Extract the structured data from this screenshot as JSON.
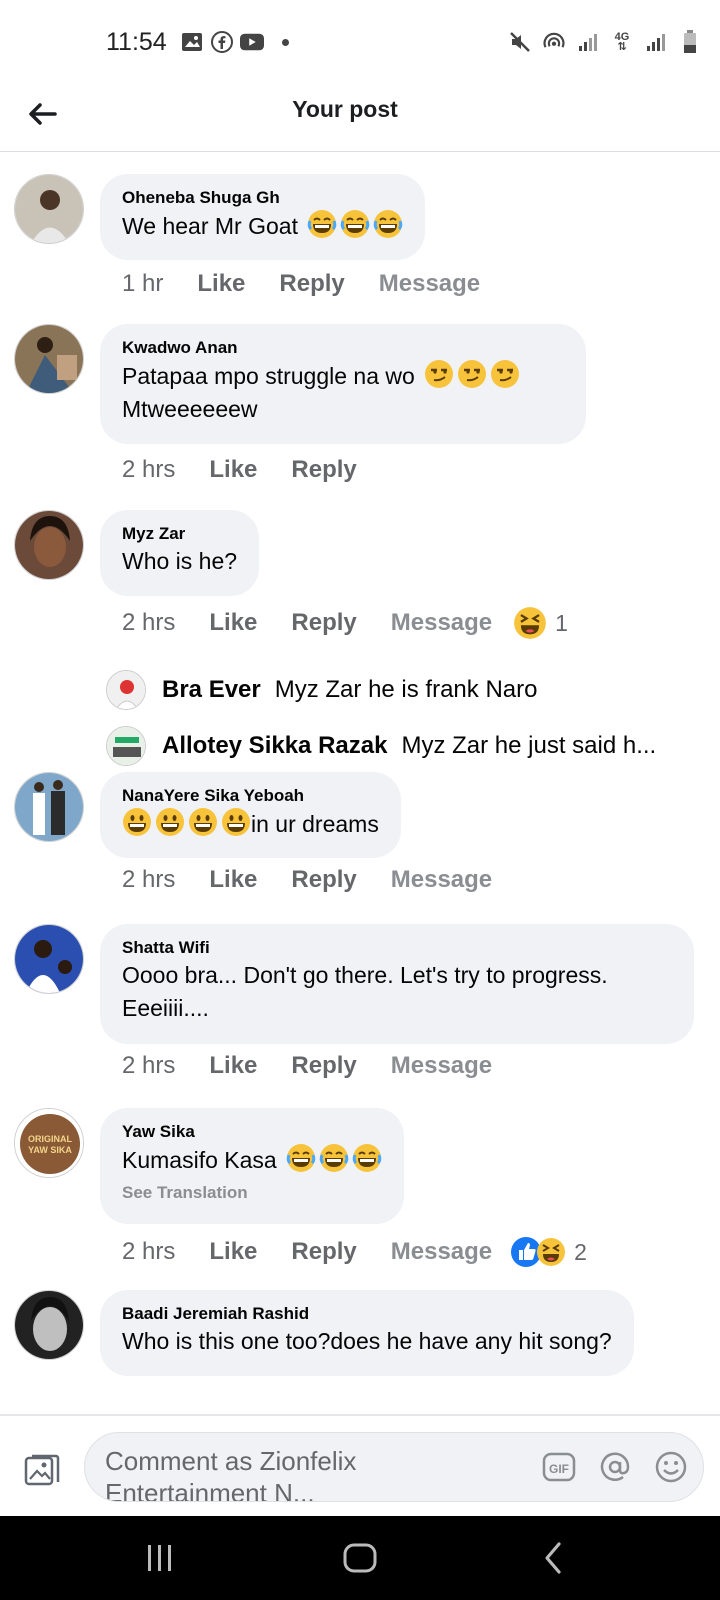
{
  "status_bar": {
    "time": "11:54",
    "icons_left": [
      "image-icon",
      "facebook-icon",
      "youtube-icon",
      "dot-icon"
    ],
    "icons_right": [
      "mute-icon",
      "hotspot-icon",
      "signal-icon",
      "4g-icon",
      "signal-icon",
      "battery-icon"
    ],
    "network_label": "4G"
  },
  "header": {
    "title": "Your post"
  },
  "comments": [
    {
      "name": "Oheneba Shuga Gh",
      "text": "We hear Mr Goat",
      "emojis": [
        "joy",
        "joy",
        "joy"
      ],
      "time": "1 hr",
      "like": "Like",
      "reply": "Reply",
      "message": "Message"
    },
    {
      "name": "Kwadwo Anan",
      "text": "Patapaa mpo struggle na wo",
      "emojis": [
        "smirk",
        "smirk",
        "smirk"
      ],
      "text2": "Mtweeeeeew",
      "time": "2 hrs",
      "like": "Like",
      "reply": "Reply"
    },
    {
      "name": "Myz Zar",
      "text": "Who is he?",
      "time": "2 hrs",
      "like": "Like",
      "reply": "Reply",
      "message": "Message",
      "reaction_count": "1",
      "replies": [
        {
          "name": "Bra Ever",
          "text": "Myz Zar he is frank Naro"
        },
        {
          "name": "Allotey Sikka Razak",
          "text": "Myz Zar he just said h..."
        }
      ]
    },
    {
      "name": "NanaYere Sika Yeboah",
      "text": "in ur dreams",
      "emojis": [
        "grin",
        "grin",
        "grin",
        "grin"
      ],
      "time": "2 hrs",
      "like": "Like",
      "reply": "Reply",
      "message": "Message"
    },
    {
      "name": "Shatta Wifi",
      "text": "Oooo bra... Don't go there. Let's try to progress.",
      "text2": "Eeeiiii....",
      "time": "2 hrs",
      "like": "Like",
      "reply": "Reply",
      "message": "Message"
    },
    {
      "name": "Yaw Sika",
      "text": "Kumasifo Kasa",
      "emojis": [
        "joy",
        "joy",
        "joy"
      ],
      "see_translation": "See Translation",
      "time": "2 hrs",
      "like": "Like",
      "reply": "Reply",
      "message": "Message",
      "reaction_count": "2",
      "avatar_text": "ORIGINAL YAW SIKA"
    },
    {
      "name": "Baadi Jeremiah Rashid",
      "text": "Who is this one too?does he have any hit song?"
    }
  ],
  "composer": {
    "placeholder": "Comment as Zionfelix Entertainment N...",
    "gif_label": "GIF"
  },
  "colors": {
    "bubble": "#f0f2f5",
    "muted": "#65676b",
    "like_blue": "#1877f2",
    "emoji_yellow": "#f7c33b"
  }
}
